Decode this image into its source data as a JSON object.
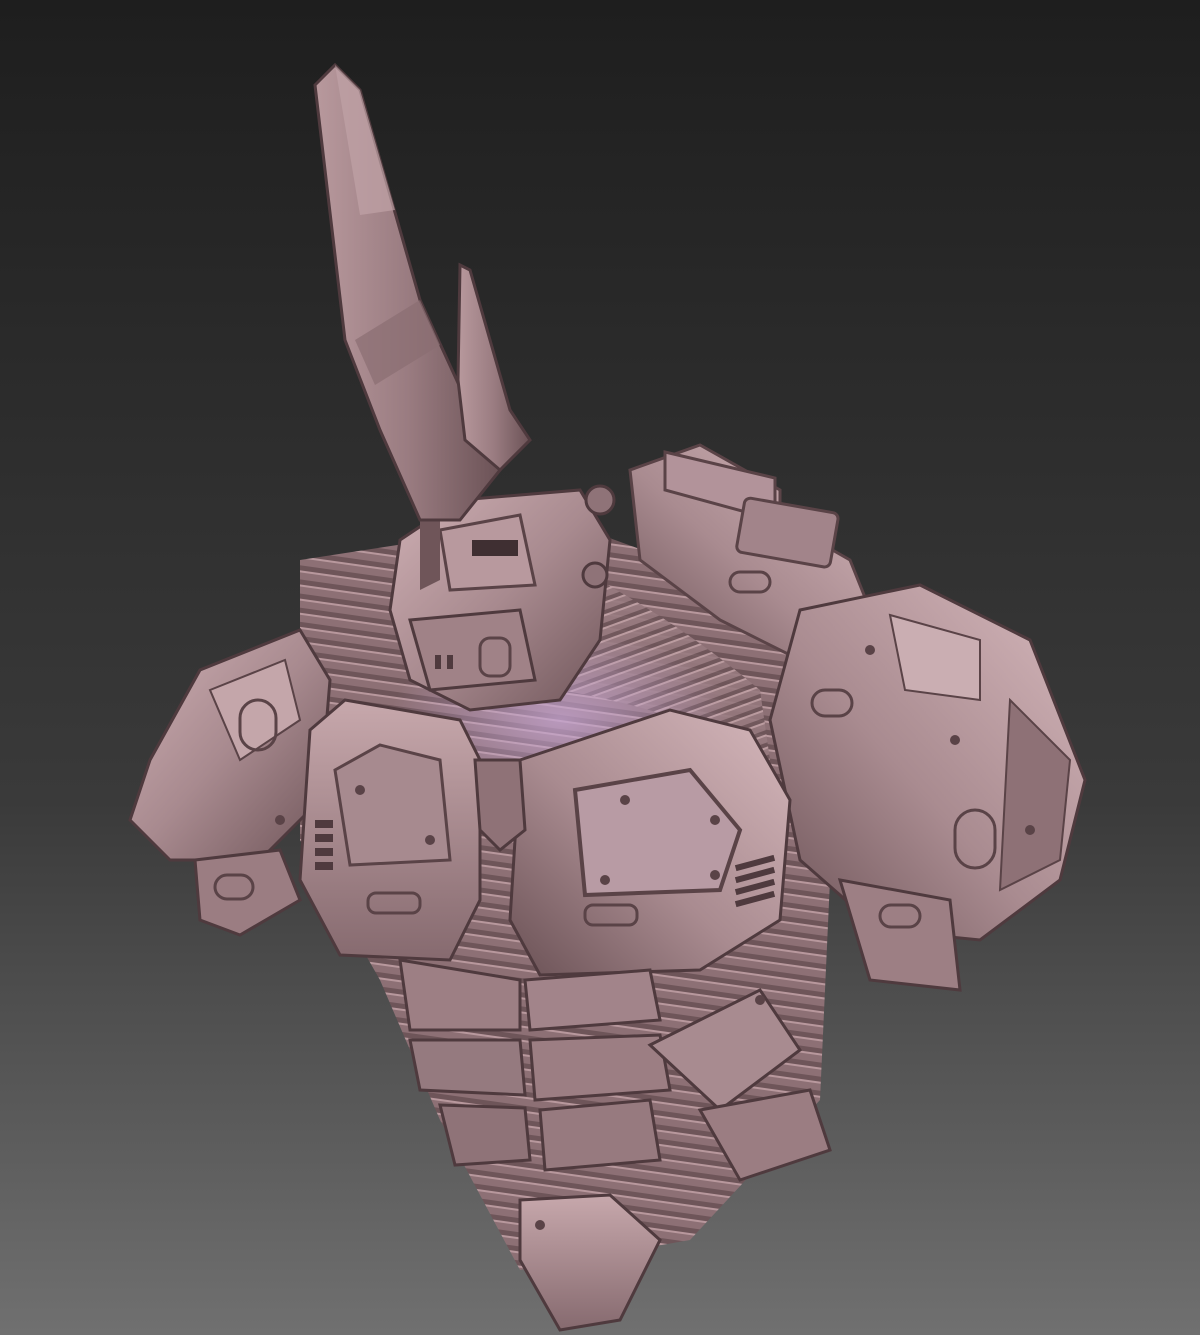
{
  "viewport": {
    "background_gradient": {
      "top": "#1e1e1e",
      "mid": "#3a3a3a",
      "bottom": "#707070"
    }
  },
  "sculpt": {
    "material_colors": {
      "base": "#9e7f84",
      "light": "#c2a2a6",
      "highlight": "#dcbfc3",
      "lavender_glow": "#c7a6d4",
      "shadow": "#5e474b",
      "deep_shadow": "#3f2f32",
      "line": "#6e5559"
    }
  }
}
